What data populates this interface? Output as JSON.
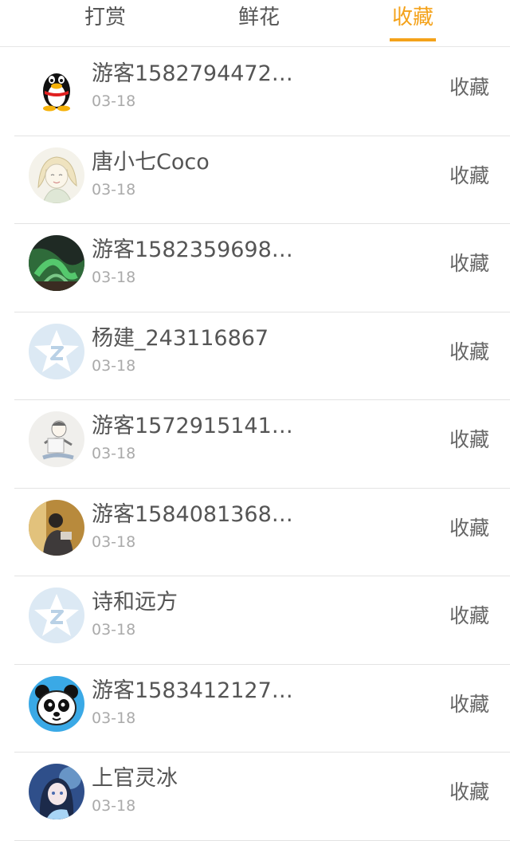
{
  "tabs": [
    {
      "label": "打赏",
      "active": false
    },
    {
      "label": "鲜花",
      "active": false
    },
    {
      "label": "收藏",
      "active": true
    }
  ],
  "accent_color": "#f4a21a",
  "items": [
    {
      "name": "游客1582794472…",
      "date": "03-18",
      "action": "收藏",
      "avatar": "qq-penguin-icon"
    },
    {
      "name": "唐小七Coco",
      "date": "03-18",
      "action": "收藏",
      "avatar": "sketch-girl-avatar"
    },
    {
      "name": "游客1582359698…",
      "date": "03-18",
      "action": "收藏",
      "avatar": "aurora-avatar"
    },
    {
      "name": "杨建_243116867",
      "date": "03-18",
      "action": "收藏",
      "avatar": "default-star-avatar"
    },
    {
      "name": "游客1572915141…",
      "date": "03-18",
      "action": "收藏",
      "avatar": "sketch-boy-avatar"
    },
    {
      "name": "游客1584081368…",
      "date": "03-18",
      "action": "收藏",
      "avatar": "photo-person-avatar"
    },
    {
      "name": "诗和远方",
      "date": "03-18",
      "action": "收藏",
      "avatar": "default-star-avatar"
    },
    {
      "name": "游客1583412127…",
      "date": "03-18",
      "action": "收藏",
      "avatar": "panda-avatar"
    },
    {
      "name": "上官灵冰",
      "date": "03-18",
      "action": "收藏",
      "avatar": "anime-girl-avatar"
    }
  ]
}
